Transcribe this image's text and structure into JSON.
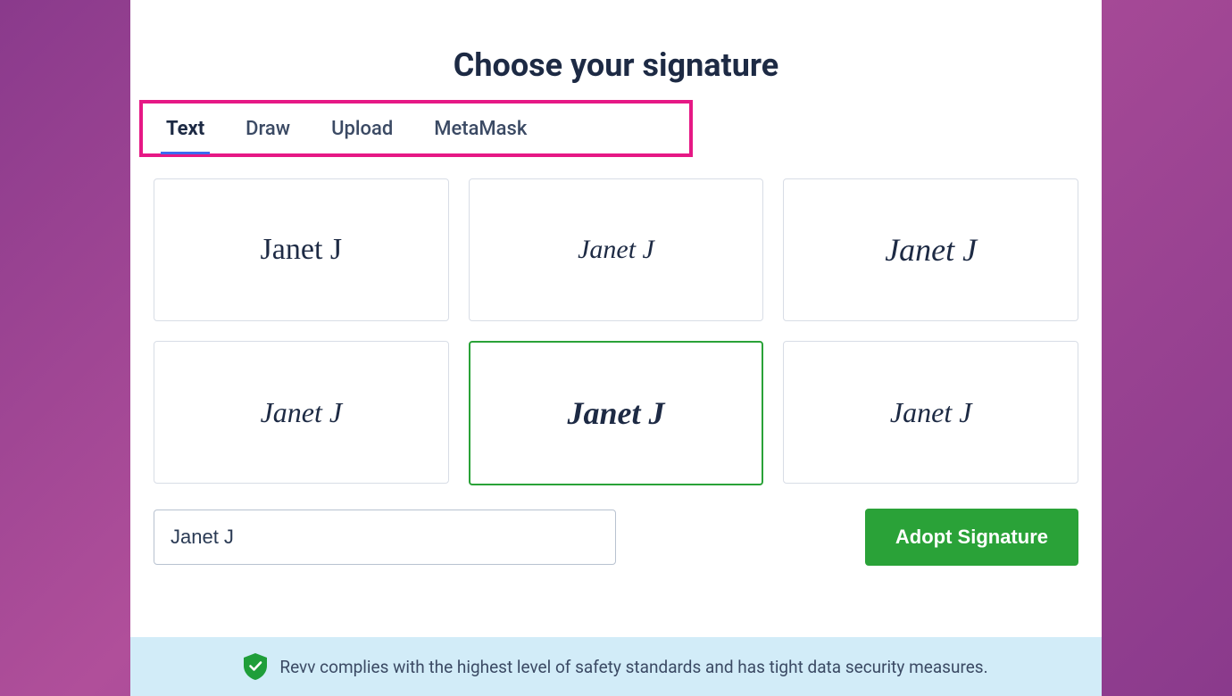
{
  "title": "Choose your signature",
  "tabs": {
    "text": "Text",
    "draw": "Draw",
    "upload": "Upload",
    "metamask": "MetaMask",
    "active": "text"
  },
  "signature_name": "Janet J",
  "signature_options": [
    {
      "label": "Janet J",
      "selected": false
    },
    {
      "label": "Janet J",
      "selected": false
    },
    {
      "label": "Janet J",
      "selected": false
    },
    {
      "label": "Janet J",
      "selected": false
    },
    {
      "label": "Janet J",
      "selected": true
    },
    {
      "label": "Janet J",
      "selected": false
    }
  ],
  "name_input_value": "Janet J",
  "adopt_button_label": "Adopt Signature",
  "footer_message": "Revv complies with the highest level of safety standards and has tight data security measures.",
  "colors": {
    "accent_pink_box": "#e61885",
    "tab_underline": "#3b6af0",
    "selected_border": "#2aa238",
    "adopt_button_bg": "#2aa238",
    "footer_bg": "#d2ecf8",
    "text_dark": "#1d2a44"
  }
}
